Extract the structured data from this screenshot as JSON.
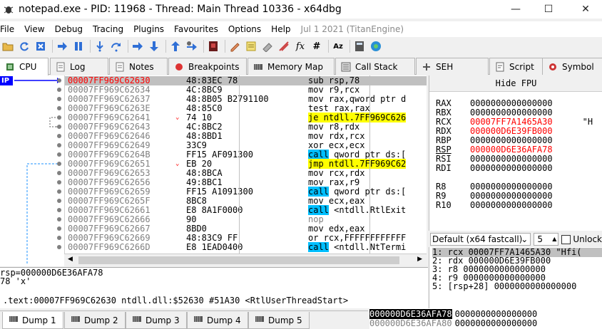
{
  "window": {
    "title": "notepad.exe - PID: 11968 - Thread: Main Thread 10336 - x64dbg",
    "minimize": "—",
    "maximize": "☐",
    "close": "✕"
  },
  "menu": [
    "File",
    "View",
    "Debug",
    "Tracing",
    "Plugins",
    "Favourites",
    "Options",
    "Help"
  ],
  "menu_date": "Jul 1 2021 (TitanEngine)",
  "toolbar": [
    "open-icon",
    "restart-icon",
    "close-icon",
    "run-icon",
    "pause-icon",
    "step-into-icon",
    "step-over-icon",
    "trace-into-icon",
    "trace-over-icon",
    "execute-till-return-icon",
    "run-to-user-code-icon",
    "patch-icon",
    "comment-icon",
    "label-icon",
    "bookmark-icon",
    "function-icon",
    "hash-icon",
    "font-icon",
    "calculator-icon",
    "help-icon"
  ],
  "tabs": [
    {
      "label": "CPU",
      "icon": "cpu-icon",
      "active": true
    },
    {
      "label": "Log",
      "icon": "log-icon"
    },
    {
      "label": "Notes",
      "icon": "notes-icon"
    },
    {
      "label": "Breakpoints",
      "icon": "breakpoint-icon"
    },
    {
      "label": "Memory Map",
      "icon": "memory-map-icon"
    },
    {
      "label": "Call Stack",
      "icon": "call-stack-icon"
    },
    {
      "label": "SEH",
      "icon": "seh-icon"
    },
    {
      "label": "Script",
      "icon": "script-icon"
    },
    {
      "label": "Symbol",
      "icon": "symbol-icon"
    }
  ],
  "ip_label": "IP",
  "disasm": [
    {
      "addr": "00007FF969C62630",
      "bytes": "48:83EC 78",
      "mn": "sub",
      "ops": " rsp,78",
      "cur": true
    },
    {
      "addr": "00007FF969C62634",
      "bytes": "4C:8BC9",
      "mn": "mov",
      "ops": " r9,rcx"
    },
    {
      "addr": "00007FF969C62637",
      "bytes": "48:8B05 B2791100",
      "mn": "mov",
      "ops": " rax,qword ptr d"
    },
    {
      "addr": "00007FF969C6263E",
      "bytes": "48:85C0",
      "mn": "test",
      "ops": " rax,rax"
    },
    {
      "addr": "00007FF969C62641",
      "bytes": "74 10",
      "mn": "je",
      "ops": " ntdll.7FF969C626",
      "kind": "jmp",
      "arrow": "v"
    },
    {
      "addr": "00007FF969C62643",
      "bytes": "4C:8BC2",
      "mn": "mov",
      "ops": " r8,rdx"
    },
    {
      "addr": "00007FF969C62646",
      "bytes": "48:8BD1",
      "mn": "mov",
      "ops": " rdx,rcx"
    },
    {
      "addr": "00007FF969C62649",
      "bytes": "33C9",
      "mn": "xor",
      "ops": " ecx,ecx"
    },
    {
      "addr": "00007FF969C6264B",
      "bytes": "FF15 AF091300",
      "mn": "call",
      "ops": " qword ptr ds:[",
      "kind": "call"
    },
    {
      "addr": "00007FF969C62651",
      "bytes": "EB 20",
      "mn": "jmp",
      "ops": " ntdll.7FF969C62",
      "kind": "jmp",
      "arrow": "v"
    },
    {
      "addr": "00007FF969C62653",
      "bytes": "48:8BCA",
      "mn": "mov",
      "ops": " rcx,rdx"
    },
    {
      "addr": "00007FF969C62656",
      "bytes": "49:8BC1",
      "mn": "mov",
      "ops": " rax,r9"
    },
    {
      "addr": "00007FF969C62659",
      "bytes": "FF15 A1091300",
      "mn": "call",
      "ops": " qword ptr ds:[",
      "kind": "call"
    },
    {
      "addr": "00007FF969C6265F",
      "bytes": "8BC8",
      "mn": "mov",
      "ops": " ecx,eax"
    },
    {
      "addr": "00007FF969C62661",
      "bytes": "E8 8A1F0000",
      "mn": "call",
      "ops": " <ntdll.RtlExit",
      "kind": "call"
    },
    {
      "addr": "00007FF969C62666",
      "bytes": "90",
      "mn": "nop",
      "ops": "",
      "gray": true
    },
    {
      "addr": "00007FF969C62667",
      "bytes": "8BD0",
      "mn": "mov",
      "ops": " edx,eax"
    },
    {
      "addr": "00007FF969C62669",
      "bytes": "48:83C9 FF",
      "mn": "or",
      "ops": " rcx,FFFFFFFFFFFF"
    },
    {
      "addr": "00007FF969C6266D",
      "bytes": "E8 1EAD0400",
      "mn": "call",
      "ops": " <ntdll.NtTermi",
      "kind": "call"
    }
  ],
  "fpu_button": "Hide FPU",
  "registers": [
    {
      "name": "RAX",
      "value": "0000000000000000"
    },
    {
      "name": "RBX",
      "value": "0000000000000000"
    },
    {
      "name": "RCX",
      "value": "00007FF7A1465A30",
      "changed": true,
      "extra": "\"H"
    },
    {
      "name": "RDX",
      "value": "000000D6E39FB000",
      "changed": true
    },
    {
      "name": "RBP",
      "value": "0000000000000000"
    },
    {
      "name": "RSP",
      "value": "000000D6E36AFA78",
      "changed": true
    },
    {
      "name": "RSI",
      "value": "0000000000000000"
    },
    {
      "name": "RDI",
      "value": "0000000000000000"
    },
    {
      "name": "",
      "value": ""
    },
    {
      "name": "R8",
      "value": "0000000000000000"
    },
    {
      "name": "R9",
      "value": "0000000000000000"
    },
    {
      "name": "R10",
      "value": "0000000000000000"
    }
  ],
  "callconv": {
    "selected": "Default (x64 fastcall)",
    "count": "5",
    "unlock_label": "Unlock"
  },
  "args": [
    "1: rcx 00007FF7A1465A30 \"Hfi(",
    "2: rdx 000000D6E39FB000",
    "3: r8 0000000000000000",
    "4: r9 0000000000000000",
    "5: [rsp+28] 0000000000000000"
  ],
  "info_lines": [
    "rsp=000000D6E36AFA78",
    "78 'x'",
    "",
    ".text:00007FF969C62630 ntdll.dll:$52630 #51A30 <RtlUserThreadStart>"
  ],
  "dump_tabs": [
    {
      "label": "Dump 1",
      "active": true
    },
    {
      "label": "Dump 2"
    },
    {
      "label": "Dump 3"
    },
    {
      "label": "Dump 4"
    },
    {
      "label": "Dump 5"
    }
  ],
  "stack": [
    {
      "addr": "000000D6E36AFA78",
      "val": "0000000000000000",
      "sel": true
    },
    {
      "addr": "000000D6E36AFA80",
      "val": "0000000000000000"
    }
  ]
}
